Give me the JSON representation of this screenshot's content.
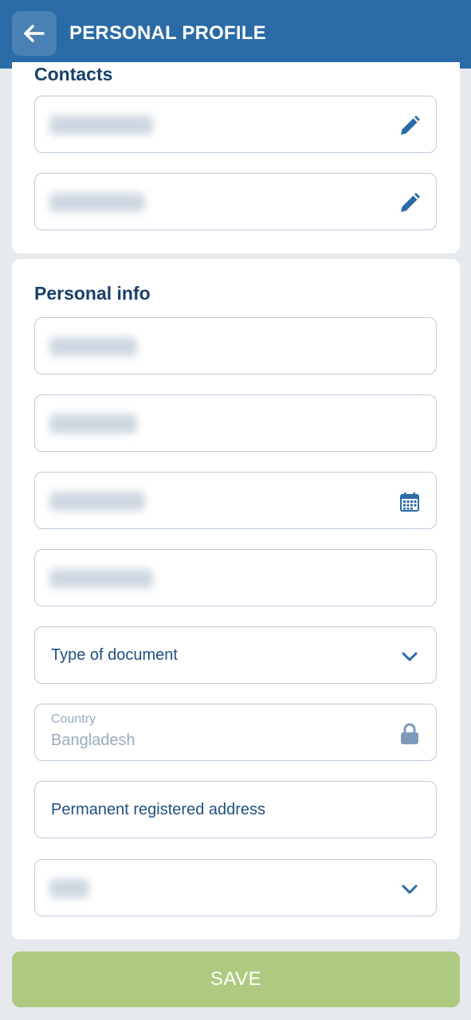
{
  "header": {
    "title": "PERSONAL PROFILE",
    "back_icon": "arrow-left-icon"
  },
  "contacts": {
    "title": "Contacts",
    "fields": [
      {
        "icon": "pencil-icon"
      },
      {
        "icon": "pencil-icon"
      }
    ]
  },
  "personal_info": {
    "title": "Personal info",
    "document_type_placeholder": "Type of document",
    "country_label": "Country",
    "country_value": "Bangladesh",
    "address_placeholder": "Permanent registered address"
  },
  "save_label": "SAVE",
  "colors": {
    "header": "#2a6ba7",
    "accent_text": "#173f6b",
    "save_button": "#adca80",
    "border": "#bccbdb"
  }
}
